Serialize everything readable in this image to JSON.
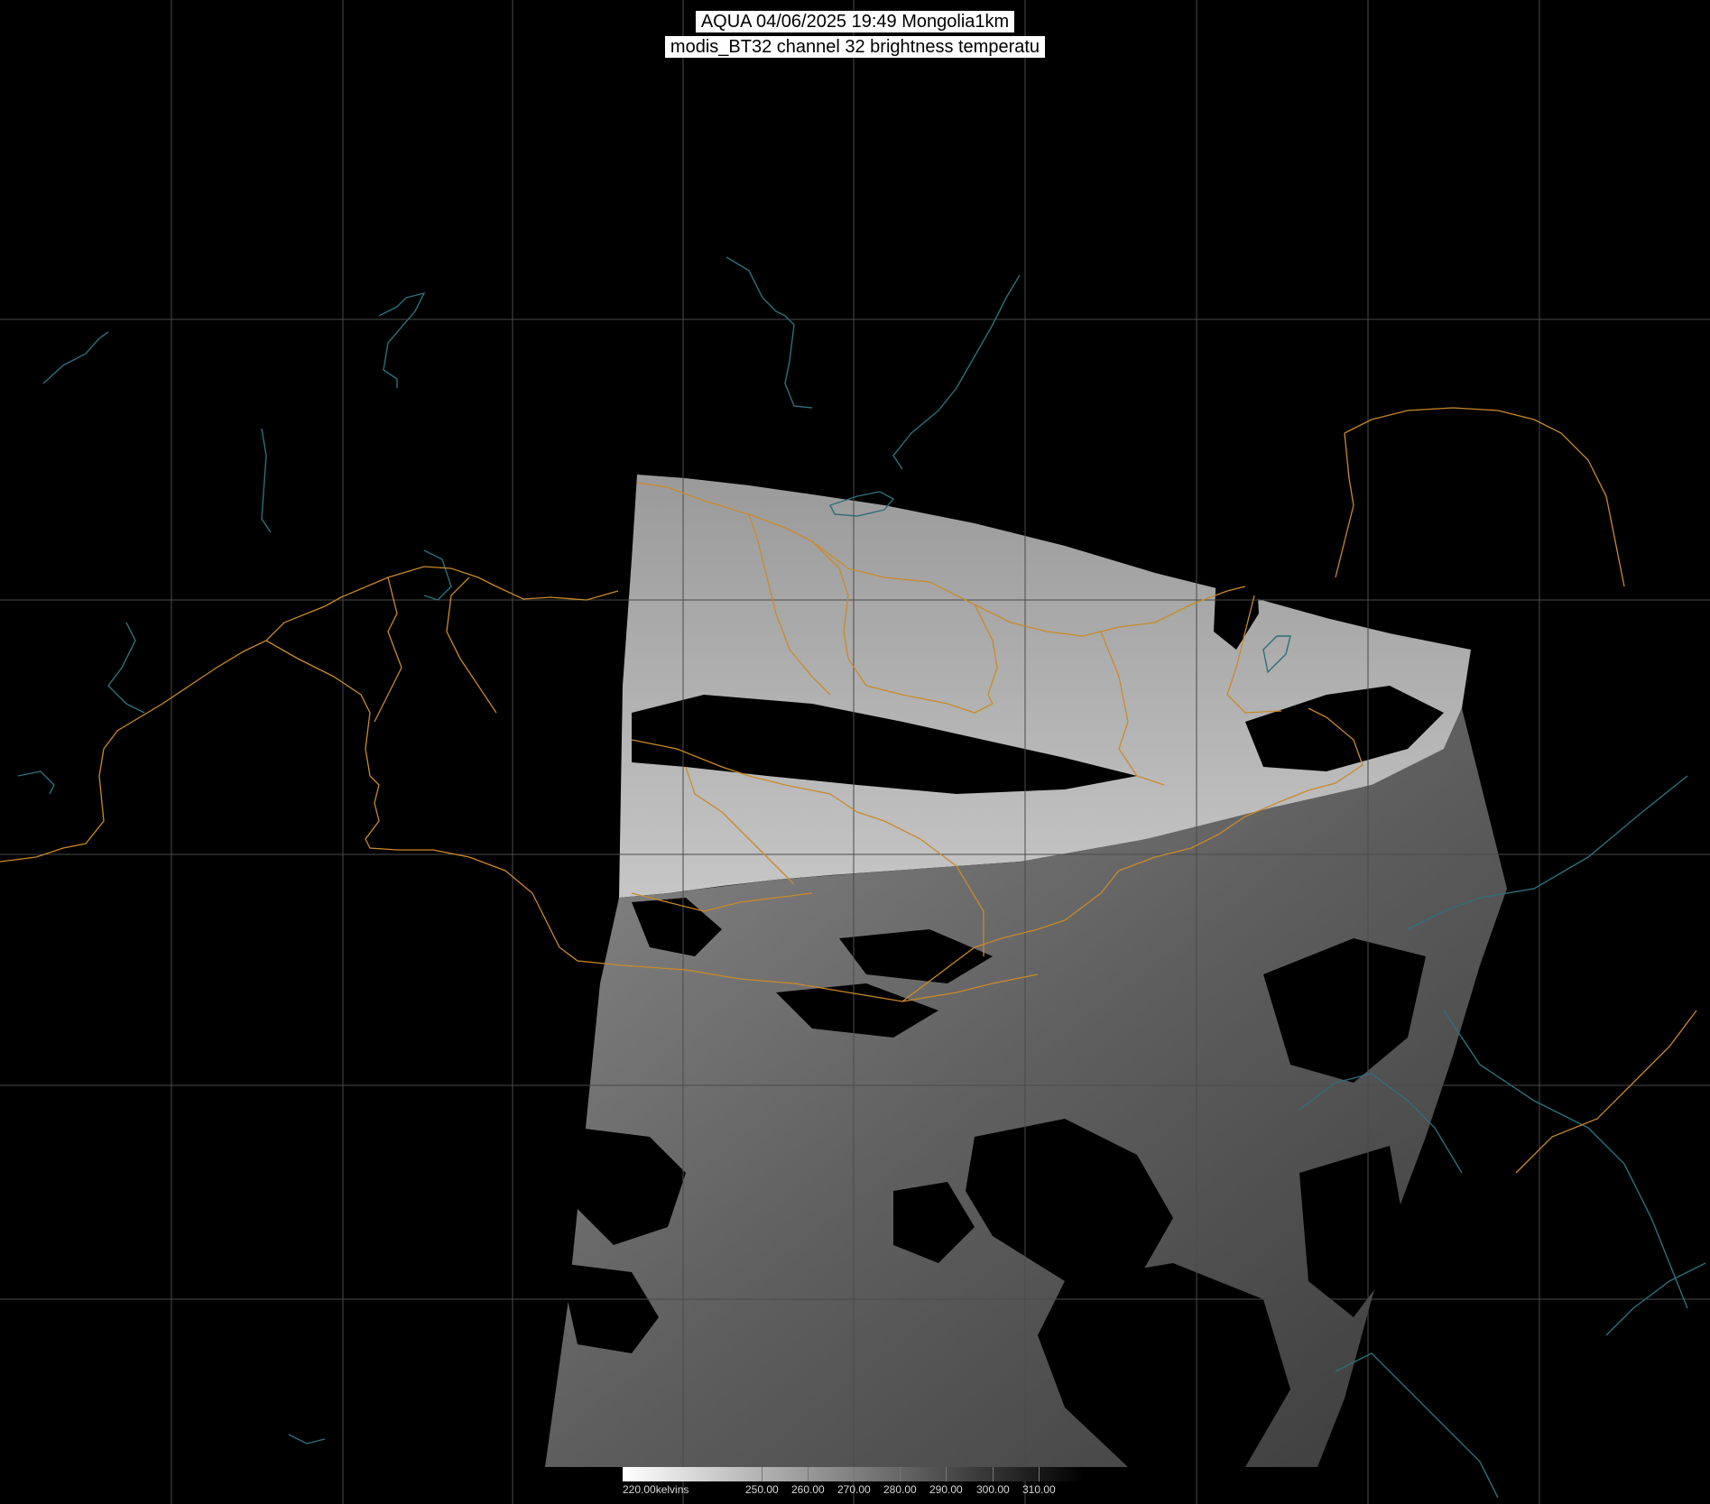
{
  "title": {
    "line1": "AQUA 04/06/2025 19:49 Mongolia1km",
    "line2": "modis_BT32 channel 32 brightness temperatu"
  },
  "colorbar": {
    "unit_label": "220.00kelvins",
    "min_kelvin": 220,
    "max_kelvin": 320,
    "ticks": [
      "250.00",
      "260.00",
      "270.00",
      "280.00",
      "290.00",
      "300.00",
      "310.00"
    ],
    "tick_values": [
      250,
      260,
      270,
      280,
      290,
      300,
      310
    ],
    "gradient": [
      "#ffffff",
      "#000000"
    ]
  },
  "map": {
    "background": "#000000",
    "grid_color": "#4a4a4a",
    "coastline_color": "#2e6f7a",
    "border_color": "#c98a2a",
    "swath_colors": [
      "#8a8a8a",
      "#b8b8b8",
      "#5a5a5a"
    ]
  }
}
